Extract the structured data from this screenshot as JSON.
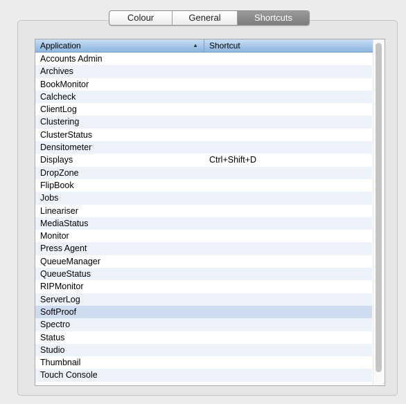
{
  "tabs": [
    {
      "label": "Colour",
      "selected": false
    },
    {
      "label": "General",
      "selected": false
    },
    {
      "label": "Shortcuts",
      "selected": true
    }
  ],
  "table": {
    "headers": {
      "application": "Application",
      "shortcut": "Shortcut",
      "sort_indicator": "▲"
    },
    "rows": [
      {
        "app": "Accounts Admin",
        "shortcut": ""
      },
      {
        "app": "Archives",
        "shortcut": ""
      },
      {
        "app": "BookMonitor",
        "shortcut": ""
      },
      {
        "app": "Calcheck",
        "shortcut": ""
      },
      {
        "app": "ClientLog",
        "shortcut": ""
      },
      {
        "app": "Clustering",
        "shortcut": ""
      },
      {
        "app": "ClusterStatus",
        "shortcut": ""
      },
      {
        "app": "Densitometer",
        "shortcut": ""
      },
      {
        "app": "Displays",
        "shortcut": "Ctrl+Shift+D"
      },
      {
        "app": "DropZone",
        "shortcut": ""
      },
      {
        "app": "FlipBook",
        "shortcut": ""
      },
      {
        "app": "Jobs",
        "shortcut": ""
      },
      {
        "app": "Lineariser",
        "shortcut": ""
      },
      {
        "app": "MediaStatus",
        "shortcut": ""
      },
      {
        "app": "Monitor",
        "shortcut": ""
      },
      {
        "app": "Press Agent",
        "shortcut": ""
      },
      {
        "app": "QueueManager",
        "shortcut": ""
      },
      {
        "app": "QueueStatus",
        "shortcut": ""
      },
      {
        "app": "RIPMonitor",
        "shortcut": ""
      },
      {
        "app": "ServerLog",
        "shortcut": ""
      },
      {
        "app": "SoftProof",
        "shortcut": "",
        "selected": true
      },
      {
        "app": "Spectro",
        "shortcut": ""
      },
      {
        "app": "Status",
        "shortcut": ""
      },
      {
        "app": "Studio",
        "shortcut": ""
      },
      {
        "app": "Thumbnail",
        "shortcut": ""
      },
      {
        "app": "Touch Console",
        "shortcut": ""
      }
    ]
  },
  "colors": {
    "selected_row": "#cfdcef",
    "alt_row": "#edf2fb",
    "header": "#a9c8e8",
    "selected_tab": "#8a8a8a"
  }
}
